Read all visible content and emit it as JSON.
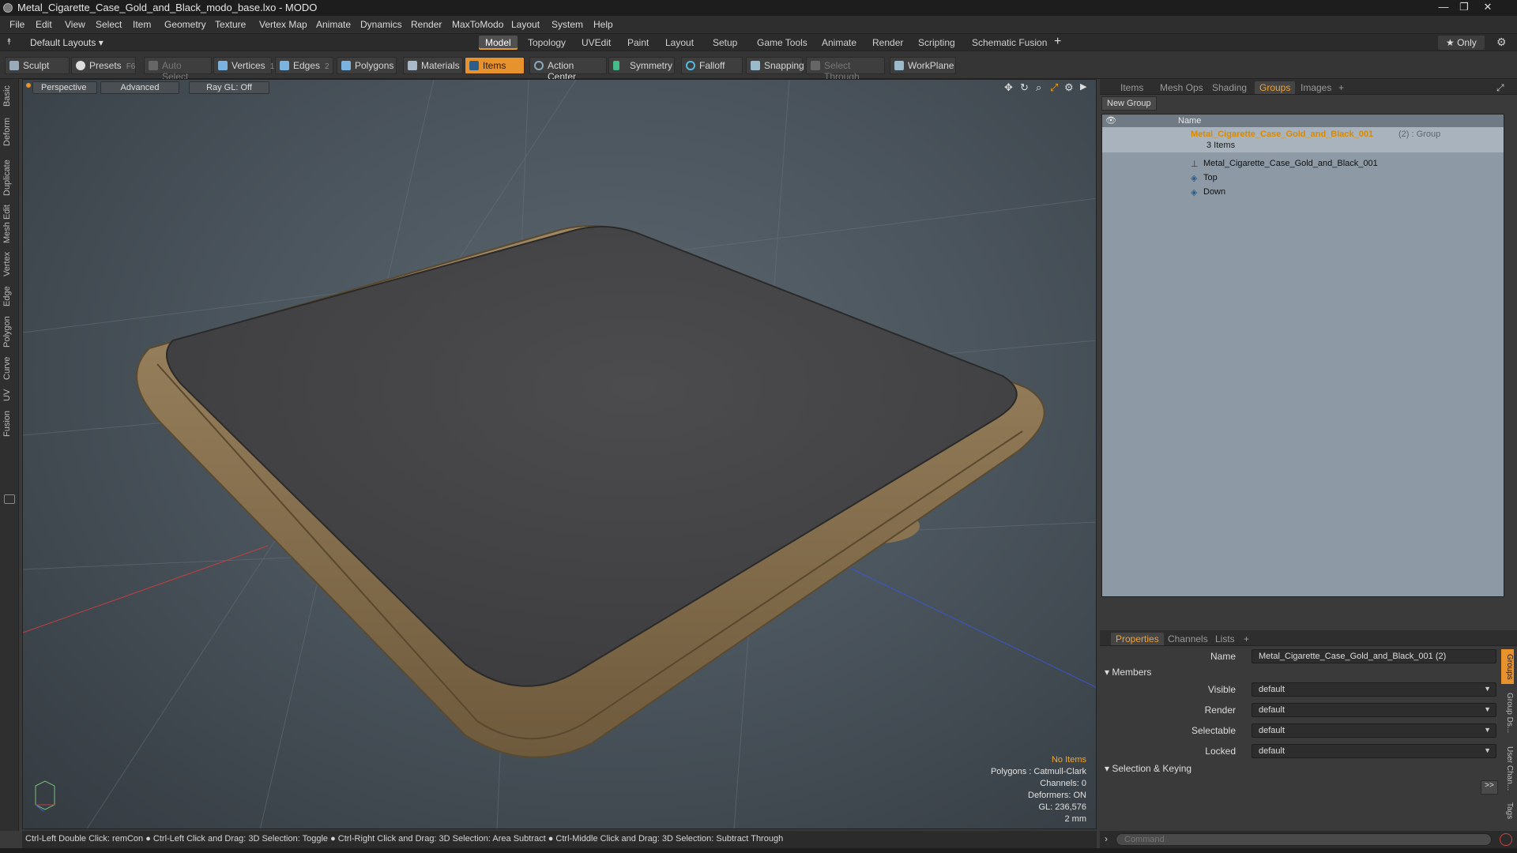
{
  "window": {
    "title": "Metal_Cigarette_Case_Gold_and_Black_modo_base.lxo - MODO"
  },
  "menu": [
    "File",
    "Edit",
    "View",
    "Select",
    "Item",
    "Geometry",
    "Texture",
    "Vertex Map",
    "Animate",
    "Dynamics",
    "Render",
    "MaxToModo",
    "Layout",
    "System",
    "Help"
  ],
  "layout": {
    "preset": "Default Layouts ▾",
    "tabs": [
      "Model",
      "Topology",
      "UVEdit",
      "Paint",
      "Layout",
      "Setup",
      "Game Tools",
      "Animate",
      "Render",
      "Scripting",
      "Schematic Fusion"
    ],
    "active_tab": "Model",
    "only_label": "★ Only"
  },
  "toolbar": {
    "sculpt": "Sculpt",
    "presets": "Presets",
    "presets_key": "F6",
    "auto_select": "Auto Select",
    "vertices": "Vertices",
    "vertices_count": "1",
    "edges": "Edges",
    "edges_count": "2",
    "polygons": "Polygons",
    "materials": "Materials",
    "items": "Items",
    "action_center": "Action Center",
    "symmetry": "Symmetry",
    "falloff": "Falloff",
    "snapping": "Snapping",
    "select_through": "Select Through",
    "workplane": "WorkPlane"
  },
  "left_tabs": [
    "Basic",
    "Deform",
    "Duplicate",
    "Mesh Edit",
    "Vertex",
    "Edge",
    "Polygon",
    "Curve",
    "UV",
    "Fusion"
  ],
  "viewport": {
    "view": "Perspective",
    "shading": "Advanced",
    "raygl": "Ray GL: Off",
    "info": {
      "items": "No Items",
      "polygons": "Polygons : Catmull-Clark",
      "channels": "Channels: 0",
      "deformers": "Deformers: ON",
      "gl": "GL: 236,576",
      "scale": "2 mm"
    }
  },
  "panel_tabs": [
    "Items",
    "Mesh Ops",
    "Shading",
    "Groups",
    "Images"
  ],
  "panel_active": "Groups",
  "groups": {
    "new_group": "New Group",
    "name_header": "Name",
    "root_name": "Metal_Cigarette_Case_Gold_and_Black_001",
    "root_suffix": "(2) : Group",
    "root_count": "3 Items",
    "children": [
      "Metal_Cigarette_Case_Gold_and_Black_001",
      "Top",
      "Down"
    ]
  },
  "props_tabs": [
    "Properties",
    "Channels",
    "Lists"
  ],
  "props": {
    "name_label": "Name",
    "name_value": "Metal_Cigarette_Case_Gold_and_Black_001 (2)",
    "members": "Members",
    "fields": [
      {
        "label": "Visible",
        "value": "default"
      },
      {
        "label": "Render",
        "value": "default"
      },
      {
        "label": "Selectable",
        "value": "default"
      },
      {
        "label": "Locked",
        "value": "default"
      }
    ],
    "sel_keying": "Selection & Keying",
    "more": ">>"
  },
  "side_tabs": [
    "Groups",
    "Group Ds...",
    "User Chan...",
    "Tags"
  ],
  "status": "Ctrl-Left Double Click: remCon ● Ctrl-Left Click and Drag: 3D Selection: Toggle ● Ctrl-Right Click and Drag: 3D Selection: Area Subtract ● Ctrl-Middle Click and Drag: 3D Selection: Subtract Through",
  "command_placeholder": "Command",
  "colors": {
    "accent": "#e8922e",
    "gold": "#8c7553",
    "leather": "#444446",
    "list_bg": "#8d9aa6"
  }
}
